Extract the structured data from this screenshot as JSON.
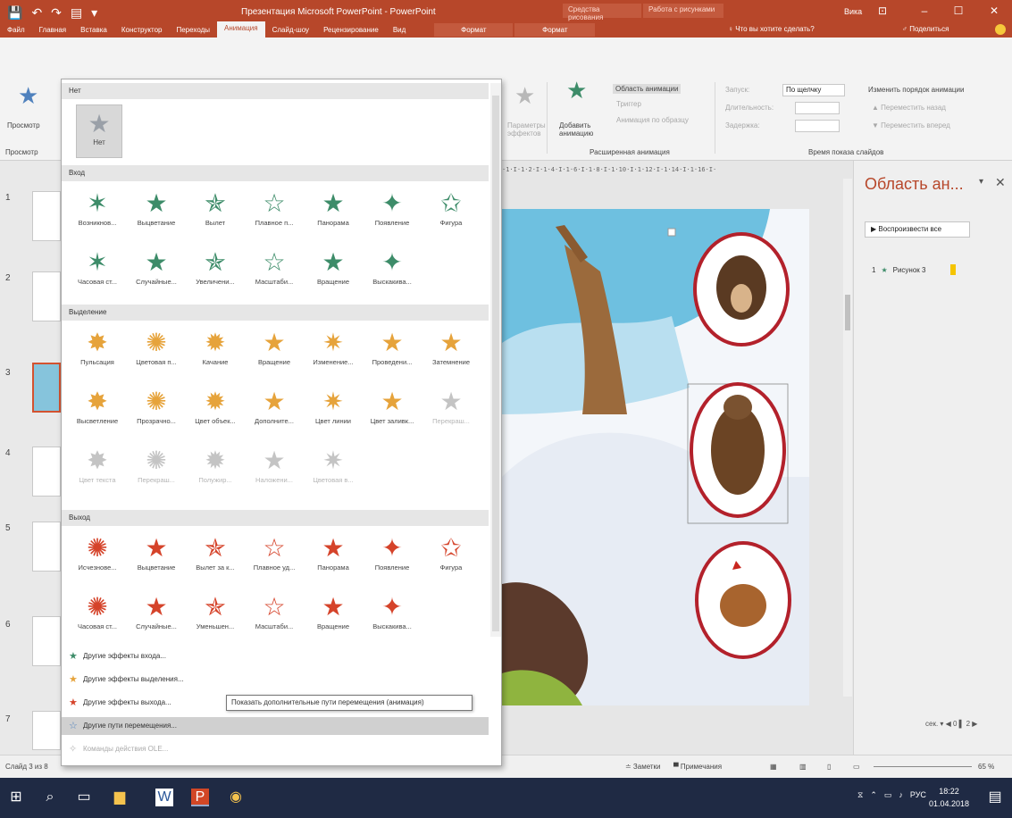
{
  "titlebar": {
    "quick_access": [
      "💾",
      "↶",
      "↷",
      "▤",
      "▾"
    ],
    "title": "Презентация Microsoft PowerPoint - PowerPoint",
    "ctx1": "Средства рисования",
    "ctx2": "Работа с рисунками",
    "user": "Вика",
    "win_buttons": [
      "⊡",
      "–",
      "☐",
      "✕"
    ]
  },
  "menu": {
    "tabs": [
      "Файл",
      "Главная",
      "Вставка",
      "Конструктор",
      "Переходы",
      "Анимация",
      "Слайд-шоу",
      "Рецензирование",
      "Вид",
      "Формат",
      "Формат"
    ],
    "active_index": 5,
    "search_help": "♀ Что вы хотите сделать?",
    "share": "♂ Поделиться"
  },
  "ribbon": {
    "preview_label": "Просмотр",
    "preview_group": "Просмотр",
    "params_label": "Параметры эффектов",
    "add_anim_label": "Добавить анимацию",
    "area_btn": "Область анимации",
    "trigger_btn": "Триггер",
    "painter_btn": "Анимация по образцу",
    "ext_group": "Расширенная анимация",
    "start_label": "Запуск:",
    "start_value": "По щелчку",
    "duration_label": "Длительность:",
    "delay_label": "Задержка:",
    "reorder_label": "Изменить порядок анимации",
    "move_earlier": "▲ Переместить назад",
    "move_later": "▼ Переместить вперед",
    "timing_group": "Время показа слайдов"
  },
  "slides_panel": {
    "numbers": [
      "1",
      "2",
      "3",
      "4",
      "5",
      "6",
      "7"
    ],
    "selected_index": 2
  },
  "ruler": "·1·I·1·2·I·1·4·I·1·6·I·1·8·I·1·10·I·1·12·I·1·14·I·1·16·I·",
  "anim_pane": {
    "title": "Область ан...",
    "menu_glyph": "▾",
    "close_glyph": "✕",
    "play_all": "▶ Воспроизвести все",
    "item_num": "1",
    "item_label": "Рисунок 3",
    "footer": "сек. ▾      ◀ 0 ▌ 2 ▶"
  },
  "gallery": {
    "none_header": "Нет",
    "none_label": "Нет",
    "entrance_header": "Вход",
    "entrance": [
      "Возникнов...",
      "Выцветание",
      "Вылет",
      "Плавное п...",
      "Панорама",
      "Появление",
      "Фигура",
      "Часовая ст...",
      "Случайные...",
      "Увеличени...",
      "Масштаби...",
      "Вращение",
      "Выскакива..."
    ],
    "emphasis_header": "Выделение",
    "emphasis": [
      "Пульсация",
      "Цветовая п...",
      "Качание",
      "Вращение",
      "Изменение...",
      "Проведени...",
      "Затемнение",
      "Высветление",
      "Прозрачно...",
      "Цвет объек...",
      "Дополните...",
      "Цвет линии",
      "Цвет заливк...",
      "Перекраш...",
      "Цвет текста",
      "Перекраш...",
      "Полужир...",
      "Наложени...",
      "Цветовая в..."
    ],
    "exit_header": "Выход",
    "exit": [
      "Исчезнове...",
      "Выцветание",
      "Вылет за к...",
      "Плавное уд...",
      "Панорама",
      "Появление",
      "Фигура",
      "Часовая ст...",
      "Случайные...",
      "Уменьшен...",
      "Масштаби...",
      "Вращение",
      "Выскакива..."
    ],
    "more": [
      "Другие эффекты входа...",
      "Другие эффекты выделения...",
      "Другие эффекты выхода...",
      "Другие пути перемещения...",
      "Команды действия OLE..."
    ],
    "tooltip": "Показать дополнительные пути перемещения (анимация)"
  },
  "statusbar": {
    "slide_info": "Слайд 3 из 8",
    "notes": "≐ Заметки",
    "comments": "▀ Примечания",
    "zoom": "65 %"
  },
  "taskbar": {
    "tray": [
      "⧖",
      "⌃",
      "▭",
      "♪",
      "РУС"
    ],
    "time": "18:22",
    "date": "01.04.2018"
  },
  "colors": {
    "brand": "#b7472a",
    "entrance_star": "#3d8c69",
    "emphasis_star": "#e6a33b",
    "exit_star": "#d5432a",
    "path_star": "#4f81bd"
  }
}
